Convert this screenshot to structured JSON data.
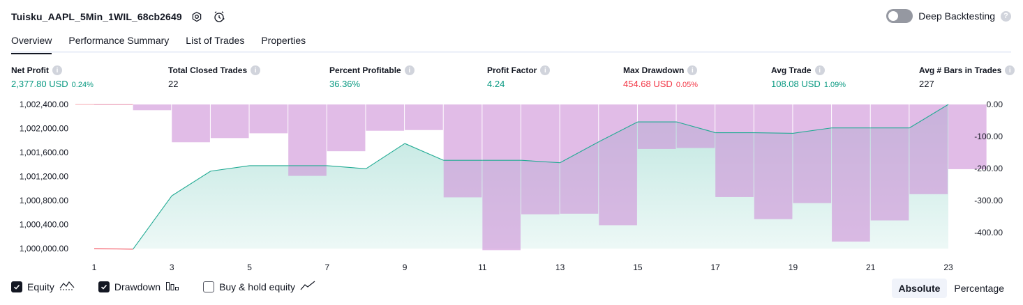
{
  "header": {
    "title": "Tuisku_AAPL_5Min_1WIL_68cb2649",
    "deep_backtesting_label": "Deep Backtesting"
  },
  "tabs": [
    {
      "label": "Overview",
      "active": true
    },
    {
      "label": "Performance Summary",
      "active": false
    },
    {
      "label": "List of Trades",
      "active": false
    },
    {
      "label": "Properties",
      "active": false
    }
  ],
  "metrics": {
    "net_profit": {
      "label": "Net Profit",
      "value": "2,377.80 USD",
      "pct": "0.24%"
    },
    "total_closed_trades": {
      "label": "Total Closed Trades",
      "value": "22"
    },
    "percent_profitable": {
      "label": "Percent Profitable",
      "value": "36.36%"
    },
    "profit_factor": {
      "label": "Profit Factor",
      "value": "4.24"
    },
    "max_drawdown": {
      "label": "Max Drawdown",
      "value": "454.68 USD",
      "pct": "0.05%"
    },
    "avg_trade": {
      "label": "Avg Trade",
      "value": "108.08 USD",
      "pct": "1.09%"
    },
    "avg_bars": {
      "label": "Avg # Bars in Trades",
      "value": "227"
    }
  },
  "colors": {
    "positive": "#089981",
    "negative": "#f23645",
    "equity_line": "#22ab94",
    "drawdown_bar": "#ce93d8"
  },
  "chart_data": {
    "type": "line+bar",
    "x_ticks": [
      "1",
      "3",
      "5",
      "7",
      "9",
      "11",
      "13",
      "15",
      "17",
      "19",
      "21",
      "23"
    ],
    "left_axis_ticks": [
      "1,002,400.00",
      "1,002,000.00",
      "1,001,600.00",
      "1,001,200.00",
      "1,000,800.00",
      "1,000,400.00",
      "1,000,000.00"
    ],
    "right_axis_ticks": [
      "0.00",
      "-100.00",
      "-200.00",
      "-300.00",
      "-400.00"
    ],
    "left_ylim": [
      1000000,
      1002400
    ],
    "right_ylim": [
      -450,
      0
    ],
    "x": [
      1,
      2,
      3,
      4,
      5,
      6,
      7,
      8,
      9,
      10,
      11,
      12,
      13,
      14,
      15,
      16,
      17,
      18,
      19,
      20,
      21,
      22,
      23
    ],
    "series": [
      {
        "name": "Equity",
        "values": [
          1000000,
          999990,
          1000880,
          1001290,
          1001380,
          1001380,
          1001380,
          1001330,
          1001750,
          1001470,
          1001470,
          1001470,
          1001430,
          1001780,
          1002110,
          1002110,
          1001930,
          1001930,
          1001920,
          1002010,
          1002010,
          1002010,
          1002400
        ]
      },
      {
        "name": "Drawdown",
        "values": [
          -2,
          -18,
          -118,
          -105,
          -90,
          -223,
          -146,
          -82,
          -80,
          -290,
          -455,
          -343,
          -341,
          -377,
          -139,
          -136,
          -289,
          -358,
          -308,
          -428,
          -362,
          -280,
          -202
        ]
      }
    ]
  },
  "legend": [
    {
      "label": "Equity",
      "checked": true
    },
    {
      "label": "Drawdown",
      "checked": true
    },
    {
      "label": "Buy & hold equity",
      "checked": false
    }
  ],
  "modes": [
    {
      "label": "Absolute",
      "active": true
    },
    {
      "label": "Percentage",
      "active": false
    }
  ]
}
